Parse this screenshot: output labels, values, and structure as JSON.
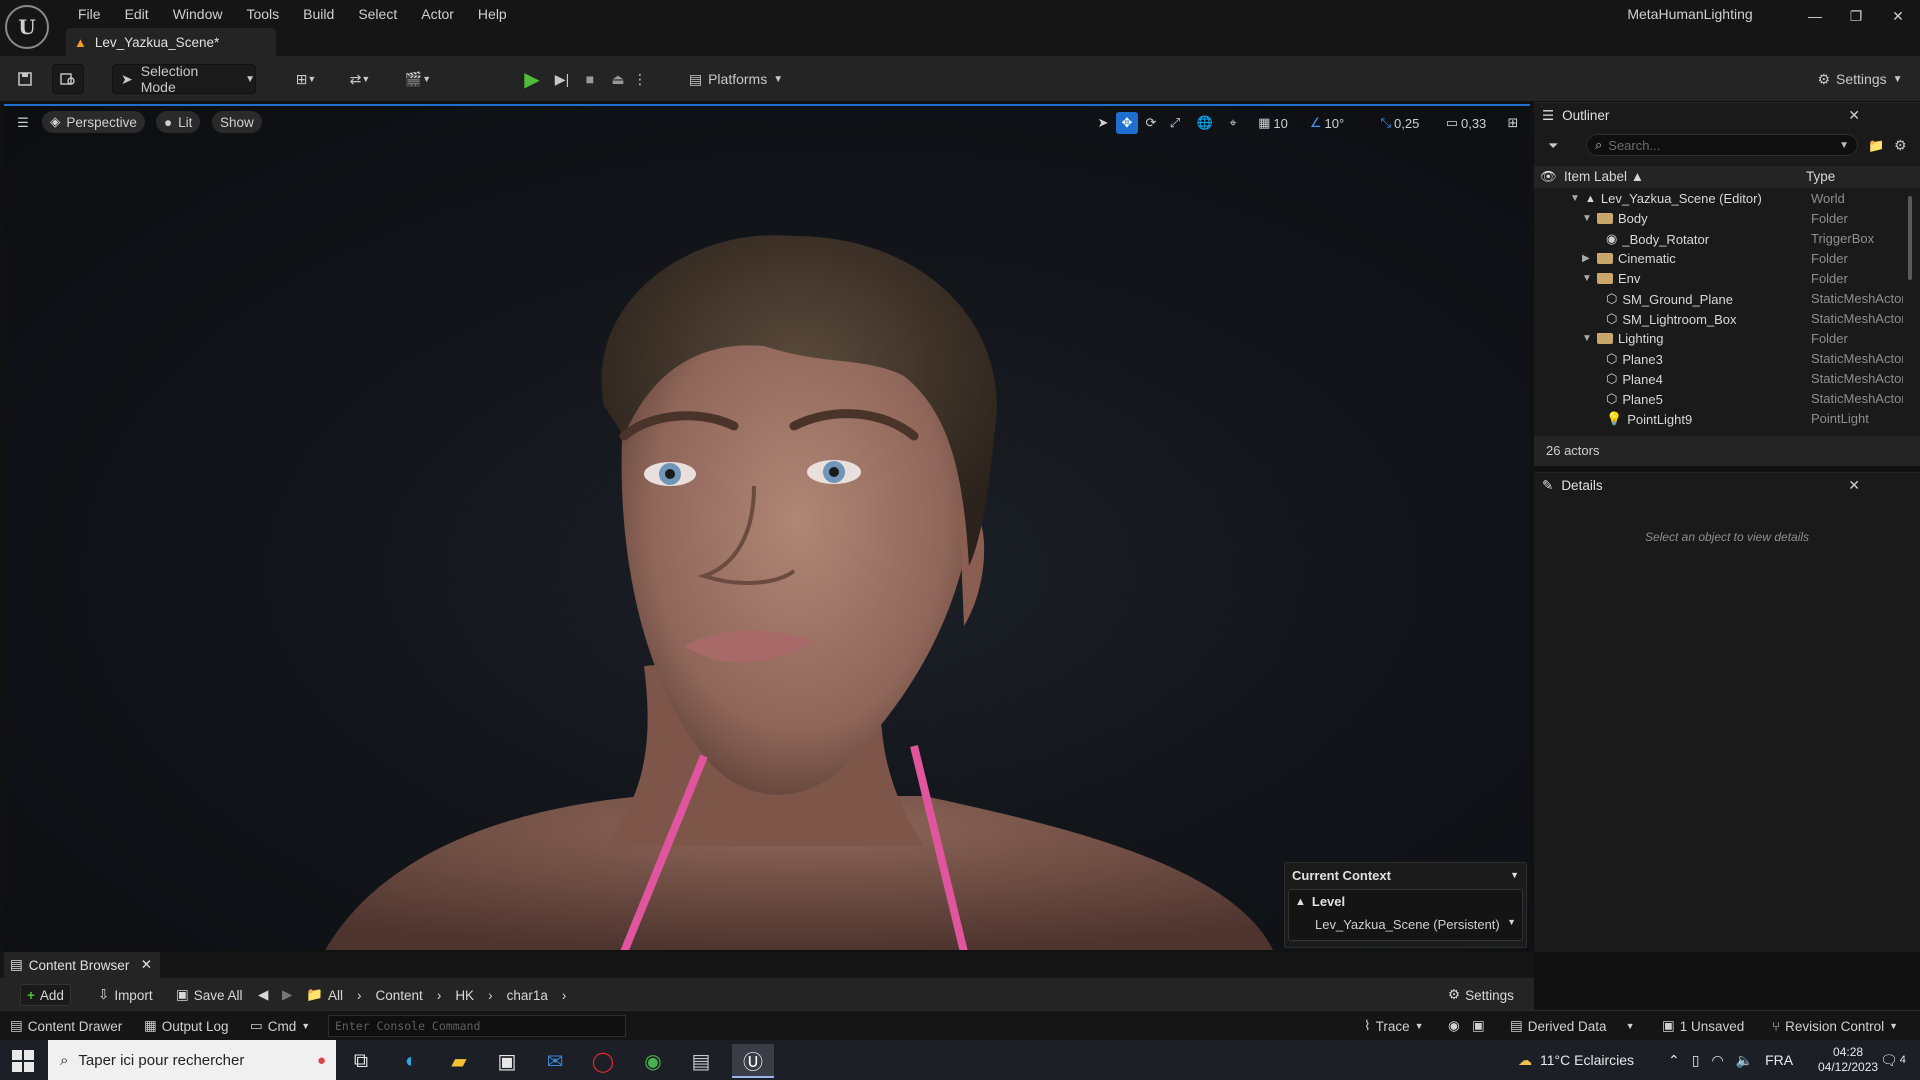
{
  "app": {
    "project_name": "MetaHumanLighting",
    "document_tab": "Lev_Yazkua_Scene*",
    "menu": [
      "File",
      "Edit",
      "Window",
      "Tools",
      "Build",
      "Select",
      "Actor",
      "Help"
    ],
    "window_controls": {
      "minimize": "—",
      "restore": "❐",
      "close": "✕"
    }
  },
  "toolbar": {
    "selection_mode": "Selection Mode",
    "platforms": "Platforms",
    "settings": "Settings"
  },
  "viewport": {
    "perspective": "Perspective",
    "lit": "Lit",
    "show": "Show",
    "grid_snap": "10",
    "rotation_snap": "10°",
    "scale_snap": "0,25",
    "camera_speed": "0,33",
    "accent": "#1f6fd1"
  },
  "context": {
    "title": "Current Context",
    "level_label": "Level",
    "level_value": "Lev_Yazkua_Scene (Persistent)"
  },
  "outliner": {
    "title": "Outliner",
    "search_placeholder": "Search...",
    "col_label": "Item Label ▲",
    "col_type": "Type",
    "rows": [
      {
        "label": "Lev_Yazkua_Scene (Editor)",
        "type": "World"
      },
      {
        "label": "Body",
        "type": "Folder"
      },
      {
        "label": "_Body_Rotator",
        "type": "TriggerBox"
      },
      {
        "label": "Cinematic",
        "type": "Folder"
      },
      {
        "label": "Env",
        "type": "Folder"
      },
      {
        "label": "SM_Ground_Plane",
        "type": "StaticMeshActor"
      },
      {
        "label": "SM_Lightroom_Box",
        "type": "StaticMeshActor"
      },
      {
        "label": "Lighting",
        "type": "Folder"
      },
      {
        "label": "Plane3",
        "type": "StaticMeshActor"
      },
      {
        "label": "Plane4",
        "type": "StaticMeshActor"
      },
      {
        "label": "Plane5",
        "type": "StaticMeshActor"
      },
      {
        "label": "PointLight9",
        "type": "PointLight"
      }
    ],
    "actor_count": "26 actors"
  },
  "details": {
    "title": "Details",
    "empty_text": "Select an object to view details"
  },
  "content_browser": {
    "tab": "Content Browser",
    "add": "Add",
    "import": "Import",
    "save_all": "Save All",
    "breadcrumb": [
      "All",
      "Content",
      "HK",
      "char1a"
    ],
    "settings": "Settings"
  },
  "statusbar": {
    "content_drawer": "Content Drawer",
    "output_log": "Output Log",
    "cmd": "Cmd",
    "console_placeholder": "Enter Console Command",
    "trace": "Trace",
    "derived_data": "Derived Data",
    "unsaved": "1 Unsaved",
    "revision_control": "Revision Control"
  },
  "taskbar": {
    "search_placeholder": "Taper ici pour rechercher",
    "weather": "11°C  Eclaircies",
    "language": "FRA",
    "time": "04:28",
    "date": "04/12/2023",
    "notifications": "4"
  }
}
